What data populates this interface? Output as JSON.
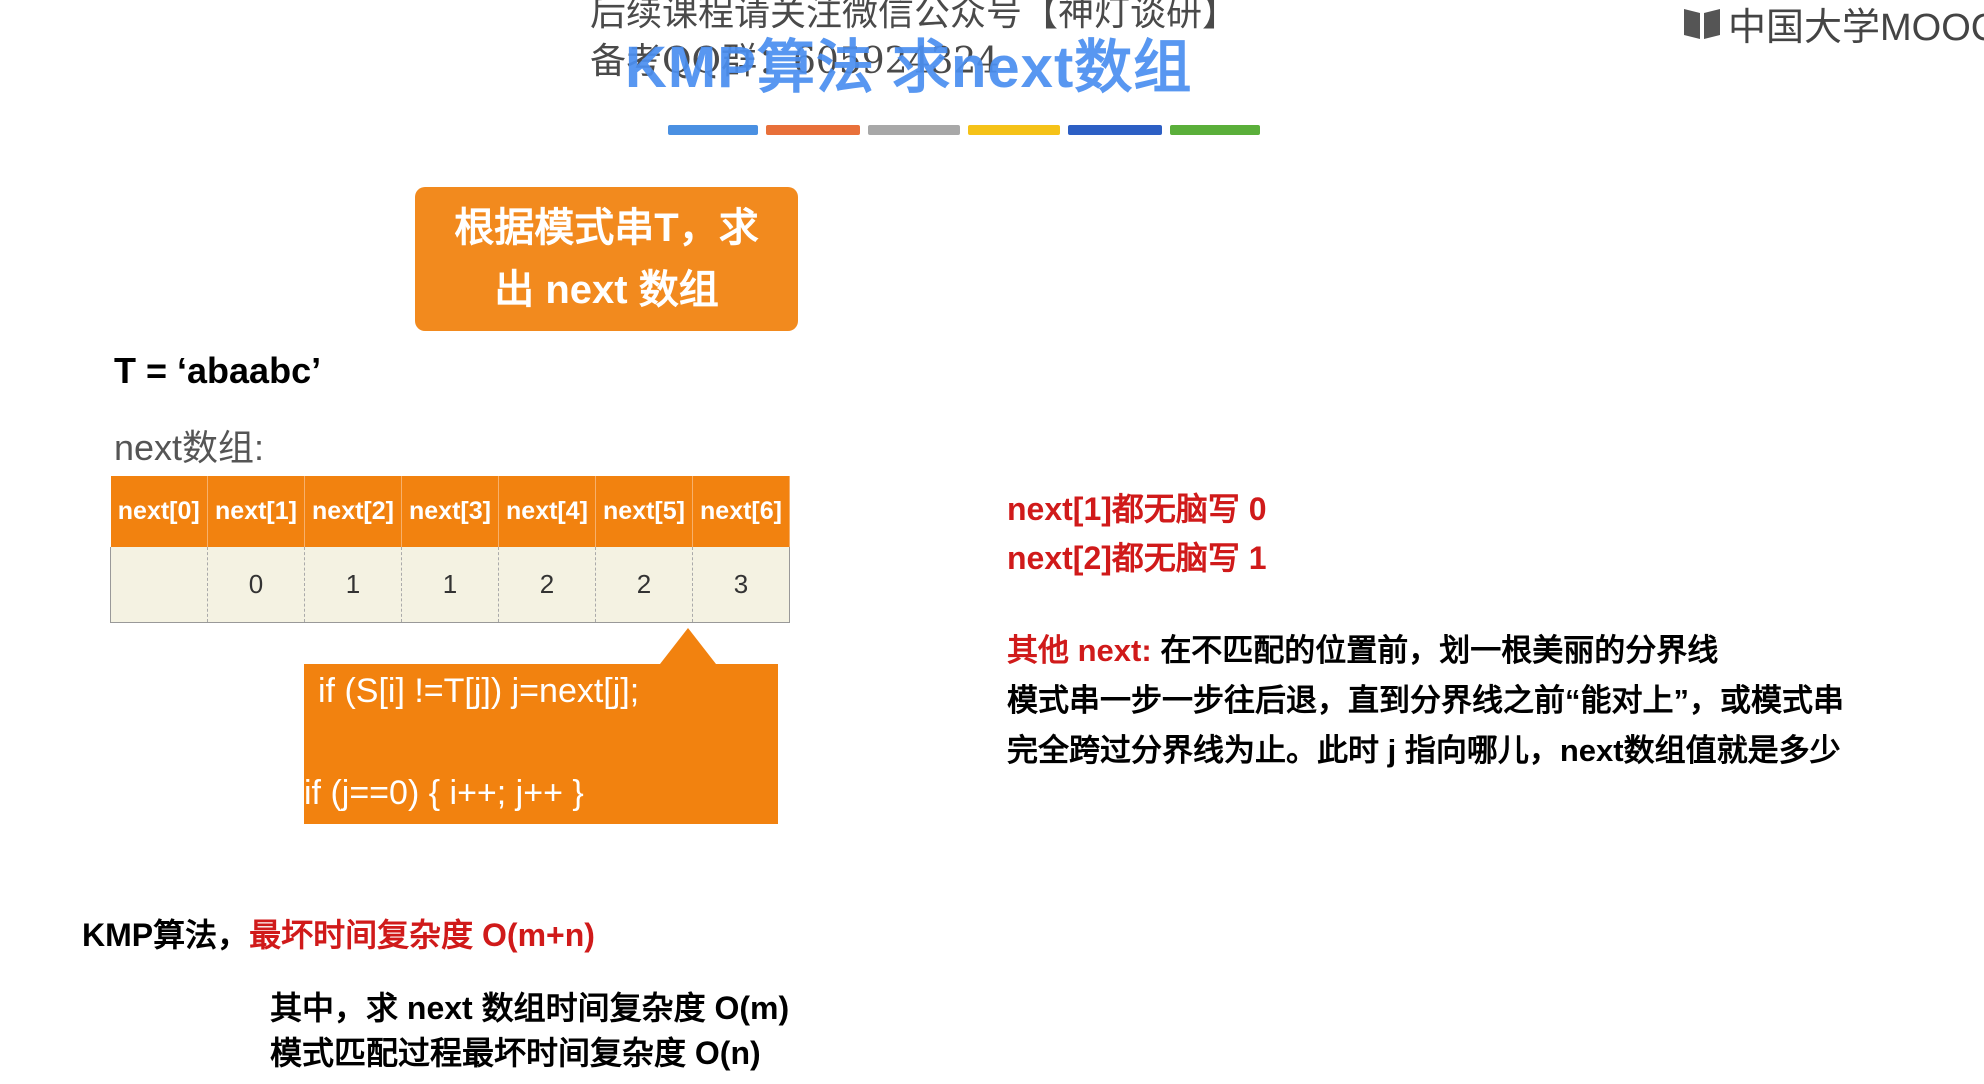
{
  "watermark": {
    "line1": "后续课程请关注微信公众号【神灯谈研】",
    "line2": "备考QQ群：605924324"
  },
  "slide": {
    "title": "KMP算法 求next数组",
    "brand": "中国大学MOOC",
    "color_bar": [
      "#4a90e2",
      "#e8703a",
      "#a8a8a8",
      "#f5c218",
      "#2d5fc4",
      "#5aaf3a"
    ],
    "heading_line1": "根据模式串T，求",
    "heading_line2": "出 next 数组",
    "t_string": "T = ‘abaabc’",
    "next_label": "next数组:",
    "table": {
      "headers": [
        "next[0]",
        "next[1]",
        "next[2]",
        "next[3]",
        "next[4]",
        "next[5]",
        "next[6]"
      ],
      "values": [
        "",
        "0",
        "1",
        "1",
        "2",
        "2",
        "3"
      ]
    },
    "code_line1": "if (S[i] !=T[j])      j=next[j];",
    "code_line2": "if (j==0)     { i++; j++ }",
    "rule1": "next[1]都无脑写 0",
    "rule2": "next[2]都无脑写 1",
    "other_label": "其他 next:",
    "other_line1": "在不匹配的位置前，划一根美丽的分界线",
    "other_line2": "模式串一步一步往后退，直到分界线之前“能对上”，或模式串",
    "other_line3": "完全跨过分界线为止。此时 j 指向哪儿，next数组值就是多少",
    "kmp_label": "KMP算法，",
    "kmp_worst": "最坏时间复杂度 O(m+n)",
    "detail1": "其中，求 next 数组时间复杂度 O(m)",
    "detail2": "模式匹配过程最坏时间复杂度 O(n)"
  }
}
